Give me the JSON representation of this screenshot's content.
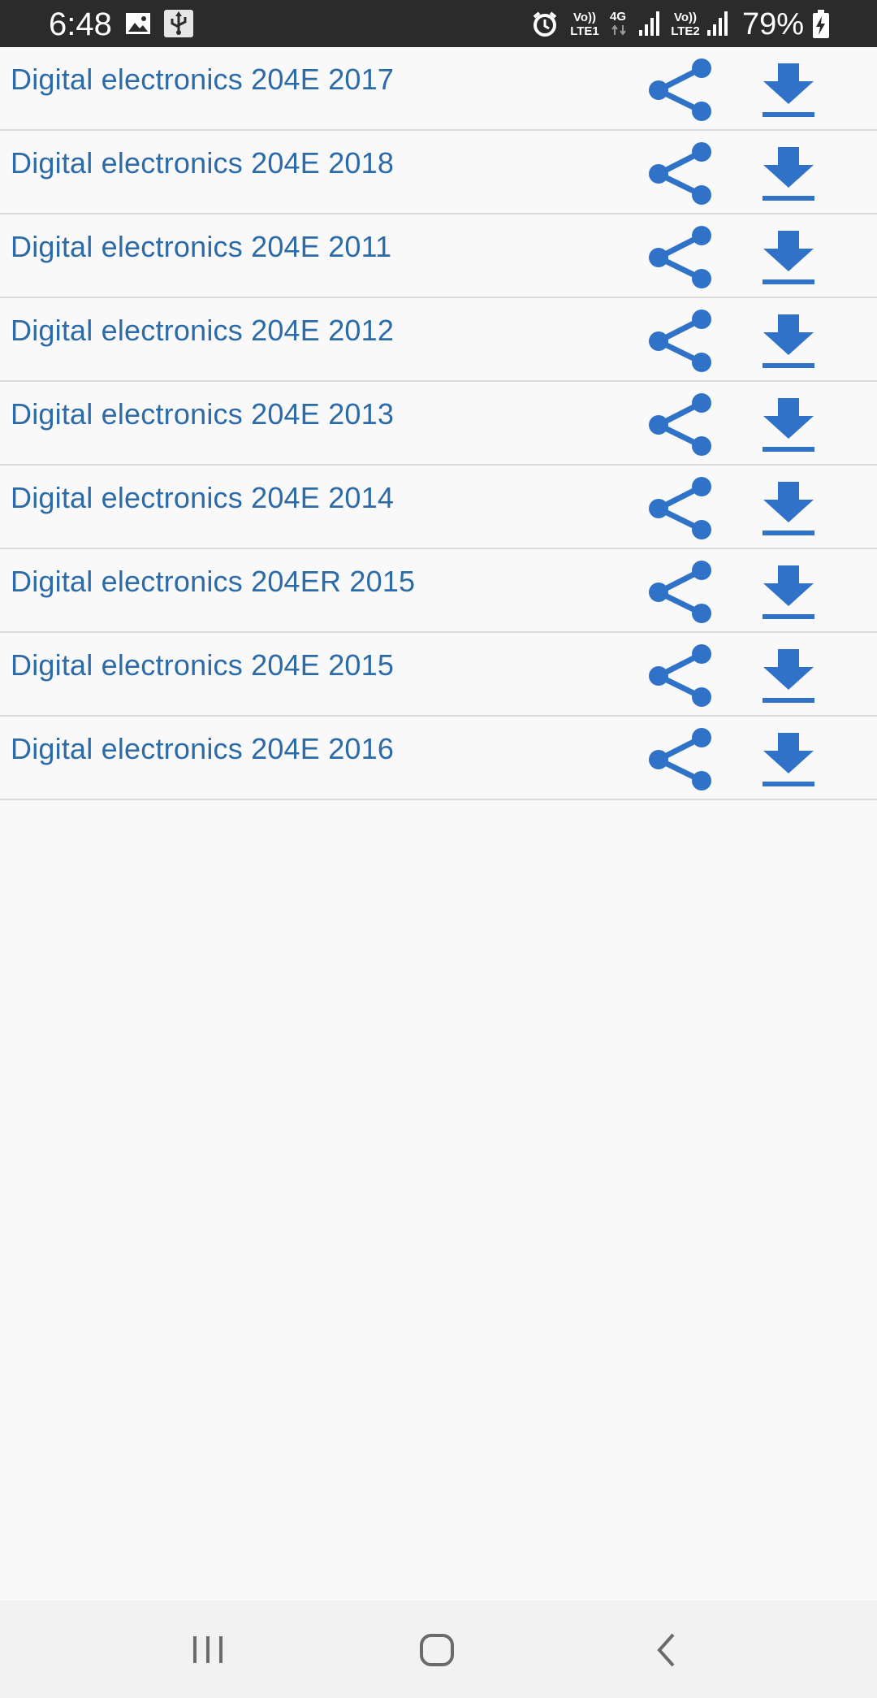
{
  "status_bar": {
    "time": "6:48",
    "battery_percent": "79%",
    "sim1_top": "Vo))",
    "sim1_bottom": "LTE1",
    "network_type": "4G",
    "sim2_top": "Vo))",
    "sim2_bottom": "LTE2",
    "icons": [
      "gallery-icon",
      "usb-icon",
      "alarm-icon",
      "signal-icon",
      "battery-charging-icon"
    ]
  },
  "list": {
    "items": [
      {
        "title": "Digital electronics 204E 2017"
      },
      {
        "title": "Digital electronics 204E 2018"
      },
      {
        "title": "Digital electronics 204E 2011"
      },
      {
        "title": "Digital electronics 204E 2012"
      },
      {
        "title": "Digital electronics 204E 2013"
      },
      {
        "title": "Digital electronics 204E 2014"
      },
      {
        "title": "Digital electronics 204ER 2015"
      },
      {
        "title": "Digital electronics 204E 2015"
      },
      {
        "title": "Digital electronics 204E 2016"
      }
    ],
    "item_actions": [
      "share-icon",
      "download-icon"
    ]
  },
  "nav_bar": {
    "buttons": [
      "recent-apps-icon",
      "home-icon",
      "back-icon"
    ]
  },
  "colors": {
    "status_bar_bg": "#2b2b2b",
    "title_text": "#2d6ba8",
    "action_icon": "#2f72c8",
    "background": "#f9f9fa",
    "divider": "#d9d9d9",
    "nav_bar_bg": "#f2f2f2",
    "nav_icon": "#6b6b6b"
  }
}
